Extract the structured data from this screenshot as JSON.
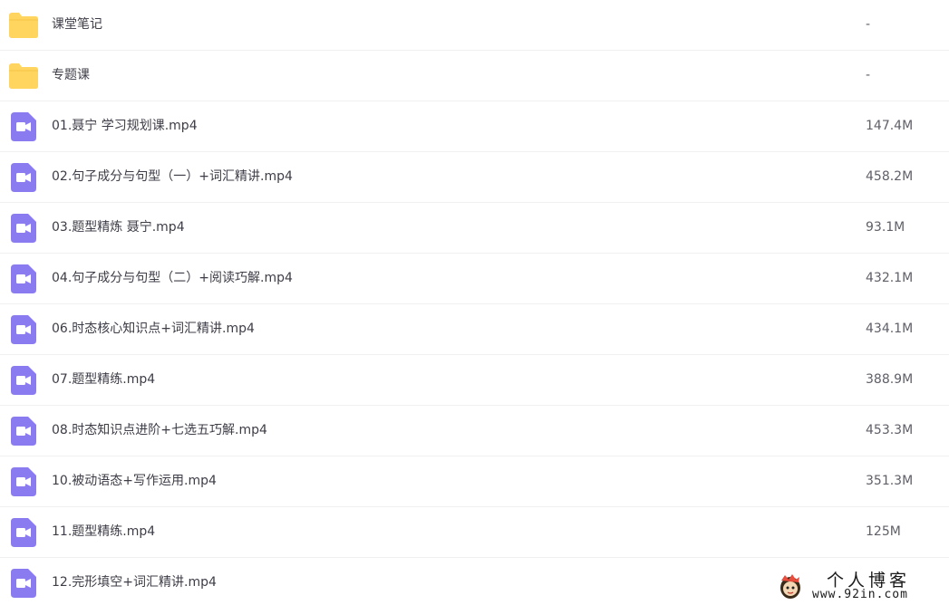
{
  "files": [
    {
      "name": "课堂笔记",
      "size": "-",
      "type": "folder"
    },
    {
      "name": "专题课",
      "size": "-",
      "type": "folder"
    },
    {
      "name": "01.聂宁 学习规划课.mp4",
      "size": "147.4M",
      "type": "video"
    },
    {
      "name": "02.句子成分与句型（一）+词汇精讲.mp4",
      "size": "458.2M",
      "type": "video"
    },
    {
      "name": "03.题型精炼 聂宁.mp4",
      "size": "93.1M",
      "type": "video"
    },
    {
      "name": "04.句子成分与句型（二）+阅读巧解.mp4",
      "size": "432.1M",
      "type": "video"
    },
    {
      "name": "06.时态核心知识点+词汇精讲.mp4",
      "size": "434.1M",
      "type": "video"
    },
    {
      "name": "07.题型精练.mp4",
      "size": "388.9M",
      "type": "video"
    },
    {
      "name": "08.时态知识点进阶+七选五巧解.mp4",
      "size": "453.3M",
      "type": "video"
    },
    {
      "name": "10.被动语态+写作运用.mp4",
      "size": "351.3M",
      "type": "video"
    },
    {
      "name": "11.题型精练.mp4",
      "size": "125M",
      "type": "video"
    },
    {
      "name": "12.完形填空+词汇精讲.mp4",
      "size": "",
      "type": "video"
    }
  ],
  "icons": {
    "folder": "folder-icon",
    "video": "video-file-icon"
  },
  "colors": {
    "folder": "#ffd45f",
    "video": "#8a7cf0",
    "text": "#3d3d47",
    "divider": "#f0f0f2"
  },
  "watermark": {
    "title": "个人博客",
    "url": "www.92in.com"
  }
}
